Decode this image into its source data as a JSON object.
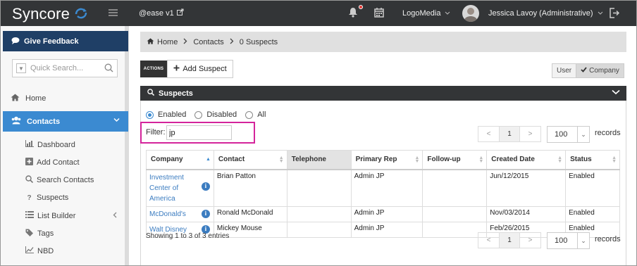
{
  "app": {
    "name": "Syncore",
    "env_label": "@ease v1",
    "org_label": "LogoMedia",
    "user_label": "Jessica Lavoy (Administrative)"
  },
  "sidebar": {
    "feedback_label": "Give Feedback",
    "search_placeholder": "Quick Search...",
    "home_label": "Home",
    "contacts_label": "Contacts",
    "sub_items": [
      {
        "label": "Dashboard",
        "icon": "chart-icon"
      },
      {
        "label": "Add Contact",
        "icon": "plus-square-icon"
      },
      {
        "label": "Search Contacts",
        "icon": "search-icon"
      },
      {
        "label": "Suspects",
        "icon": "question-icon"
      },
      {
        "label": "List Builder",
        "icon": "list-icon"
      },
      {
        "label": "Tags",
        "icon": "tags-icon"
      },
      {
        "label": "NBD",
        "icon": "line-chart-icon"
      }
    ]
  },
  "breadcrumb": {
    "home": "Home",
    "contacts": "Contacts",
    "current": "0 Suspects"
  },
  "toolbar": {
    "actions_label": "ACTIONS",
    "add_label": "Add Suspect",
    "toggle_user": "User",
    "toggle_company": "Company"
  },
  "panel": {
    "title": "Suspects",
    "radio_enabled": "Enabled",
    "radio_disabled": "Disabled",
    "radio_all": "All",
    "filter_label": "Filter:",
    "filter_value": "jp",
    "page_current": "1",
    "page_size": "100",
    "records_label": "records",
    "showing_text": "Showing 1 to 3 of 3 entries"
  },
  "table": {
    "headers": [
      "Company",
      "Contact",
      "Telephone",
      "Primary Rep",
      "Follow-up",
      "Created Date",
      "Status"
    ],
    "rows": [
      {
        "company": "Investment Center of America",
        "contact": "Brian Patton",
        "telephone": "",
        "rep": "Admin JP",
        "followup": "",
        "created": "Jun/12/2015",
        "status": "Enabled"
      },
      {
        "company": "McDonald's",
        "contact": "Ronald McDonald",
        "telephone": "",
        "rep": "Admin JP",
        "followup": "",
        "created": "Nov/03/2014",
        "status": "Enabled"
      },
      {
        "company": "Walt Disney",
        "contact": "Mickey Mouse",
        "telephone": "",
        "rep": "Admin JP",
        "followup": "",
        "created": "Feb/26/2015",
        "status": "Enabled"
      }
    ]
  },
  "colors": {
    "topbar": "#333537",
    "feedback": "#1f3f66",
    "contacts_active": "#3b8ad1",
    "filter_highlight": "#d4249b",
    "link": "#3b7cc0"
  }
}
